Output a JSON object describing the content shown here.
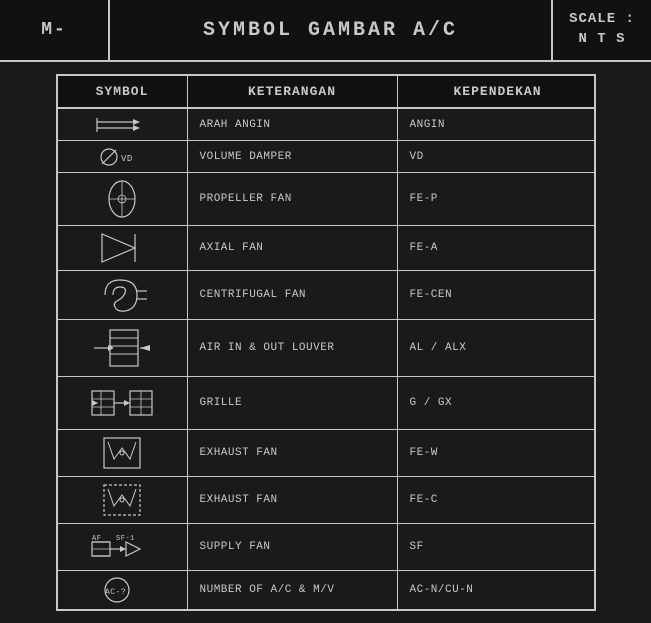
{
  "header": {
    "left_label": "M-",
    "center_label": "SYMBOL GAMBAR A/C",
    "scale_label": "SCALE :",
    "nts_label": "N T S"
  },
  "table": {
    "columns": [
      "SYMBOL",
      "KETERANGAN",
      "KEPENDEKAN"
    ],
    "rows": [
      {
        "symbol_type": "arah-angin",
        "keterangan": "ARAH ANGIN",
        "kependekan": "ANGIN"
      },
      {
        "symbol_type": "volume-damper",
        "keterangan": "VOLUME DAMPER",
        "kependekan": "VD"
      },
      {
        "symbol_type": "propeller-fan",
        "keterangan": "PROPELLER FAN",
        "kependekan": "FE-P"
      },
      {
        "symbol_type": "axial-fan",
        "keterangan": "AXIAL FAN",
        "kependekan": "FE-A"
      },
      {
        "symbol_type": "centrifugal-fan",
        "keterangan": "CENTRIFUGAL FAN",
        "kependekan": "FE-CEN"
      },
      {
        "symbol_type": "air-louver",
        "keterangan": "AIR IN & OUT LOUVER",
        "kependekan": "AL / ALX"
      },
      {
        "symbol_type": "grille",
        "keterangan": "GRILLE",
        "kependekan": "G / GX"
      },
      {
        "symbol_type": "exhaust-fan-w",
        "keterangan": "EXHAUST FAN",
        "kependekan": "FE-W"
      },
      {
        "symbol_type": "exhaust-fan-c",
        "keterangan": "EXHAUST FAN",
        "kependekan": "FE-C"
      },
      {
        "symbol_type": "supply-fan",
        "keterangan": "SUPPLY FAN",
        "kependekan": "SF"
      },
      {
        "symbol_type": "number-ac",
        "keterangan": "NUMBER OF A/C & M/V",
        "kependekan": "AC-N/CU-N"
      }
    ]
  }
}
